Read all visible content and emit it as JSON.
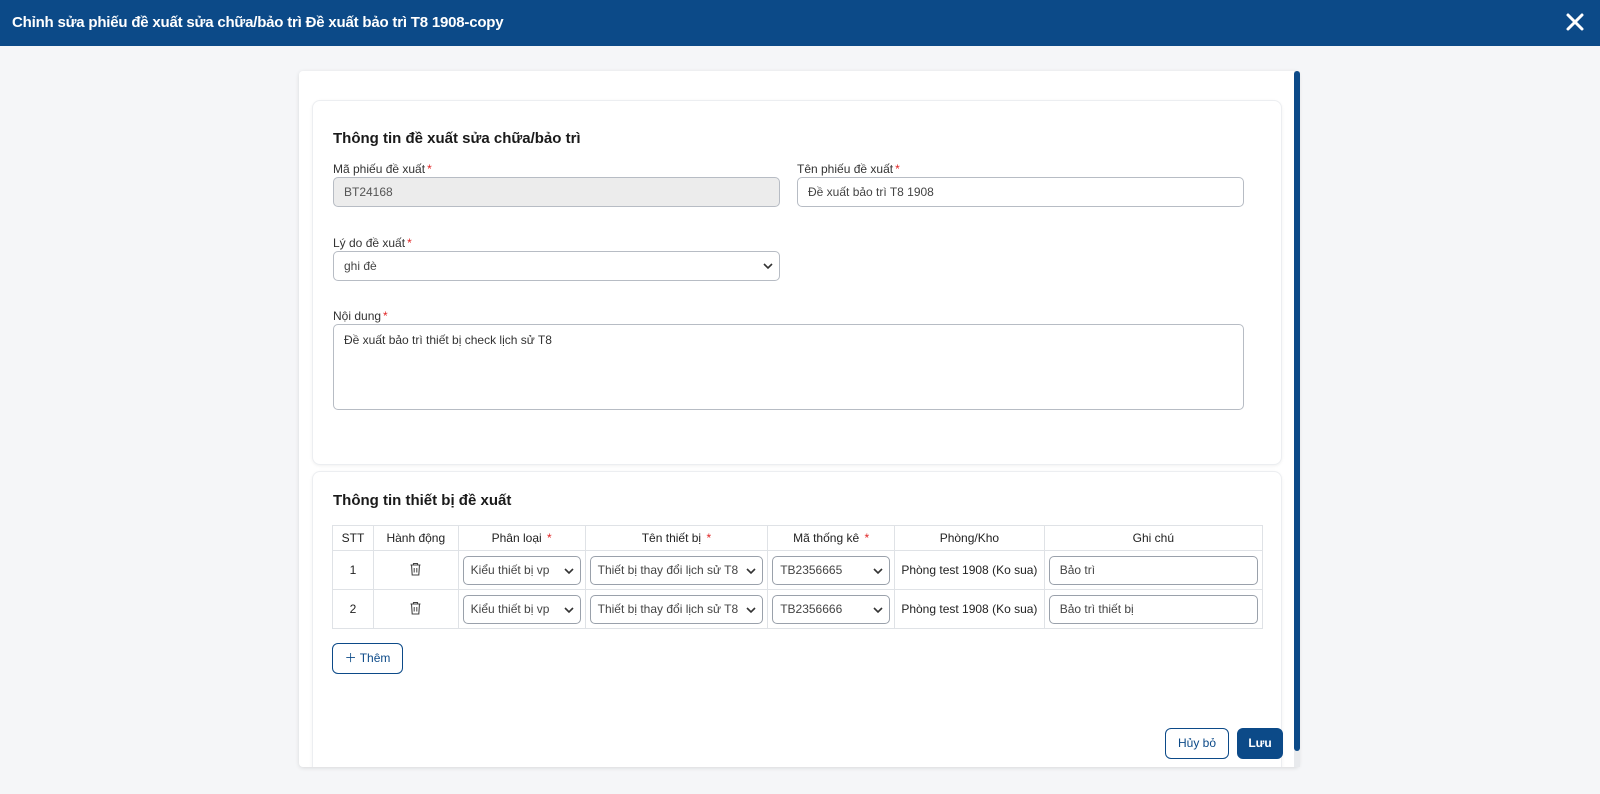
{
  "header": {
    "title": "Chỉnh sửa phiếu đề xuất sửa chữa/bảo trì Đề xuất bảo trì T8 1908-copy",
    "close_icon": "close-icon"
  },
  "info_section": {
    "title": "Thông tin đề xuất sửa chữa/bảo trì",
    "code_label": "Mã phiếu đề xuất",
    "code_value": "BT24168",
    "name_label": "Tên phiếu đề xuất",
    "name_placeholder": "Đề xuất bảo trì T8 1908",
    "reason_label": "Lý do đề xuất",
    "reason_value": "ghi đè",
    "content_label": "Nội dung",
    "content_value": "Đề xuất bảo trì thiết bị check lịch sử T8",
    "required_mark": "*"
  },
  "devices_section": {
    "title": "Thông tin thiết bị đề xuất",
    "columns": [
      "STT",
      "Hành động",
      "Phân loại",
      "Tên thiết bị",
      "Mã thống kê",
      "Phòng/Kho",
      "Ghi chú"
    ],
    "required_mark": "*",
    "rows": [
      {
        "stt": "1",
        "category": "Kiểu thiết bị vp",
        "device": "Thiết bị thay đổi lịch sử T8",
        "code": "TB2356665",
        "room": "Phòng test 1908 (Ko sua)",
        "note": "Bảo trì"
      },
      {
        "stt": "2",
        "category": "Kiểu thiết bị vp",
        "device": "Thiết bị thay đổi lịch sử T8",
        "code": "TB2356666",
        "room": "Phòng test 1908 (Ko sua)",
        "note": "Bảo trì thiết bị"
      }
    ],
    "add_label": "Thêm"
  },
  "footer": {
    "cancel_label": "Hủy bỏ",
    "save_label": "Lưu"
  },
  "colors": {
    "primary": "#0c4a88",
    "required": "#e02424"
  }
}
